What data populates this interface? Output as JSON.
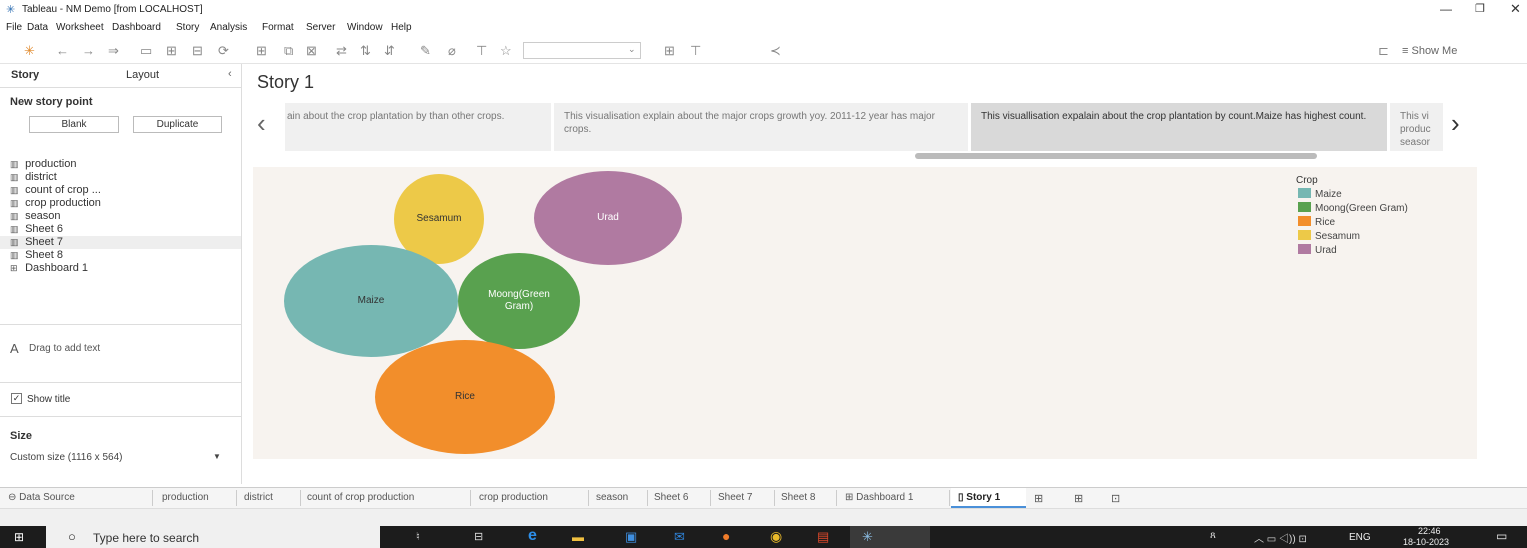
{
  "window": {
    "title": "Tableau - NM Demo [from LOCALHOST]"
  },
  "menu": [
    "File",
    "Data",
    "Worksheet",
    "Dashboard",
    "Story",
    "Analysis",
    "Format",
    "Server",
    "Window",
    "Help"
  ],
  "toolbar": {
    "show_me": "Show Me"
  },
  "sidebar": {
    "tab_story": "Story",
    "tab_layout": "Layout",
    "new_story_point": "New story point",
    "blank": "Blank",
    "duplicate": "Duplicate",
    "sheets": [
      {
        "label": "production",
        "icon": "worksheet-icon"
      },
      {
        "label": "district",
        "icon": "worksheet-icon"
      },
      {
        "label": "count of crop ...",
        "icon": "worksheet-icon"
      },
      {
        "label": "crop production",
        "icon": "worksheet-icon"
      },
      {
        "label": "season",
        "icon": "worksheet-icon"
      },
      {
        "label": "Sheet 6",
        "icon": "worksheet-icon"
      },
      {
        "label": "Sheet 7",
        "icon": "worksheet-icon"
      },
      {
        "label": "Sheet 8",
        "icon": "worksheet-icon"
      },
      {
        "label": "Dashboard 1",
        "icon": "dashboard-icon"
      }
    ],
    "drag_text": "Drag to add text",
    "show_title": "Show title",
    "size_label": "Size",
    "size_value": "Custom size (1116 x 564)"
  },
  "story": {
    "title": "Story 1",
    "points": [
      "ain about the crop plantation by than other crops.",
      "This visualisation explain about the major crops growth yoy. 2011-12 year has major crops.",
      "This visuallisation expalain about the crop plantation by count.Maize has highest count.",
      "This vi produc seasor"
    ]
  },
  "chart_data": {
    "type": "packed-bubble",
    "legend_title": "Crop",
    "legend_placement": "top-right",
    "items": [
      {
        "label": "Maize",
        "color": "#76b7b2"
      },
      {
        "label": "Moong(Green Gram)",
        "color": "#59a14f"
      },
      {
        "label": "Rice",
        "color": "#f28e2b"
      },
      {
        "label": "Sesamum",
        "color": "#edc948"
      },
      {
        "label": "Urad",
        "color": "#b07aa1"
      }
    ]
  },
  "tabs": [
    "Data Source",
    "production",
    "district",
    "count of crop production",
    "crop production",
    "season",
    "Sheet 6",
    "Sheet 7",
    "Sheet 8",
    "Dashboard 1",
    "Story 1"
  ],
  "taskbar": {
    "search": "Type here to search",
    "lang": "ENG",
    "time": "22:46",
    "date": "18-10-2023"
  }
}
